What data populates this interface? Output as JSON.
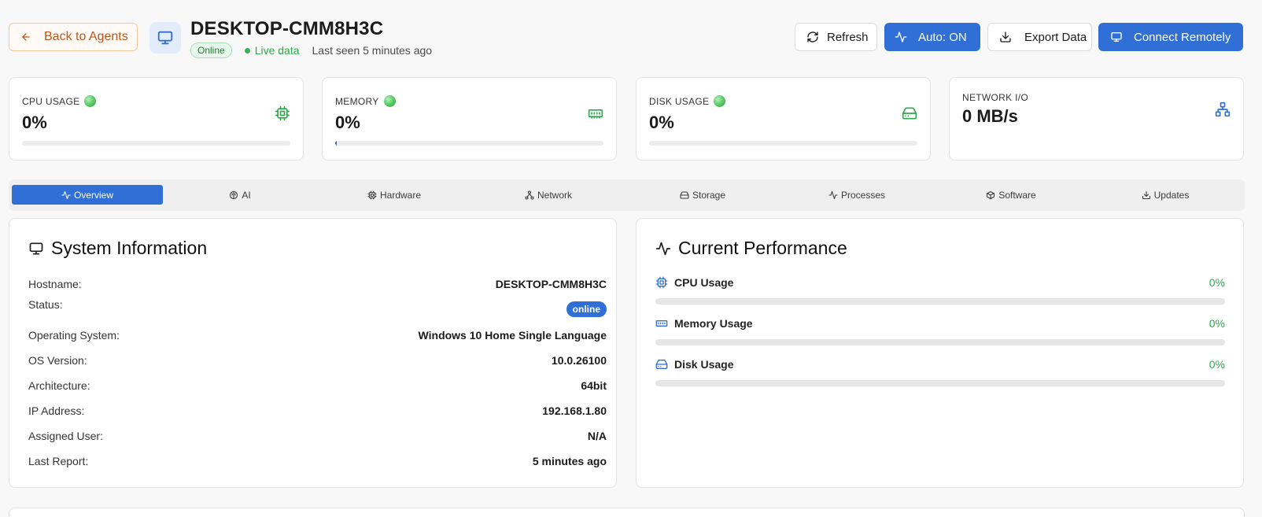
{
  "header": {
    "back_label": "Back to Agents",
    "title": "DESKTOP-CMM8H3C",
    "status_badge": "Online",
    "live_label": "Live data",
    "last_seen": "Last seen 5 minutes ago",
    "buttons": {
      "refresh": "Refresh",
      "auto": "Auto: ON",
      "export": "Export Data",
      "connect": "Connect Remotely"
    }
  },
  "metrics": [
    {
      "label": "CPU USAGE",
      "value": "0%",
      "progress": 0,
      "status": "green"
    },
    {
      "label": "MEMORY",
      "value": "0%",
      "progress": 0.5,
      "status": "green"
    },
    {
      "label": "DISK USAGE",
      "value": "0%",
      "progress": 0,
      "status": "green"
    },
    {
      "label": "NETWORK I/O",
      "value": "0 MB/s"
    }
  ],
  "tabs": [
    {
      "label": "Overview",
      "icon": "activity-icon",
      "active": true
    },
    {
      "label": "AI",
      "icon": "brain-icon"
    },
    {
      "label": "Hardware",
      "icon": "cpu-icon"
    },
    {
      "label": "Network",
      "icon": "network-icon"
    },
    {
      "label": "Storage",
      "icon": "hard-drive-icon"
    },
    {
      "label": "Processes",
      "icon": "activity-icon"
    },
    {
      "label": "Software",
      "icon": "package-icon"
    },
    {
      "label": "Updates",
      "icon": "download-icon"
    }
  ],
  "system_info": {
    "title": "System Information",
    "rows": [
      {
        "key": "Hostname:",
        "value": "DESKTOP-CMM8H3C"
      },
      {
        "key": "Status:",
        "value": "online"
      },
      {
        "key": "Operating System:",
        "value": "Windows 10 Home Single Language"
      },
      {
        "key": "OS Version:",
        "value": "10.0.26100"
      },
      {
        "key": "Architecture:",
        "value": "64bit"
      },
      {
        "key": "IP Address:",
        "value": "192.168.1.80"
      },
      {
        "key": "Assigned User:",
        "value": "N/A"
      },
      {
        "key": "Last Report:",
        "value": "5 minutes ago"
      }
    ]
  },
  "performance": {
    "title": "Current Performance",
    "items": [
      {
        "name": "CPU Usage",
        "value": "0%",
        "progress": 0
      },
      {
        "name": "Memory Usage",
        "value": "0%",
        "progress": 0
      },
      {
        "name": "Disk Usage",
        "value": "0%",
        "progress": 0
      }
    ]
  },
  "colors": {
    "accent": "#2f6fd6",
    "success": "#2ea84a",
    "back_button": "#c0561a"
  }
}
